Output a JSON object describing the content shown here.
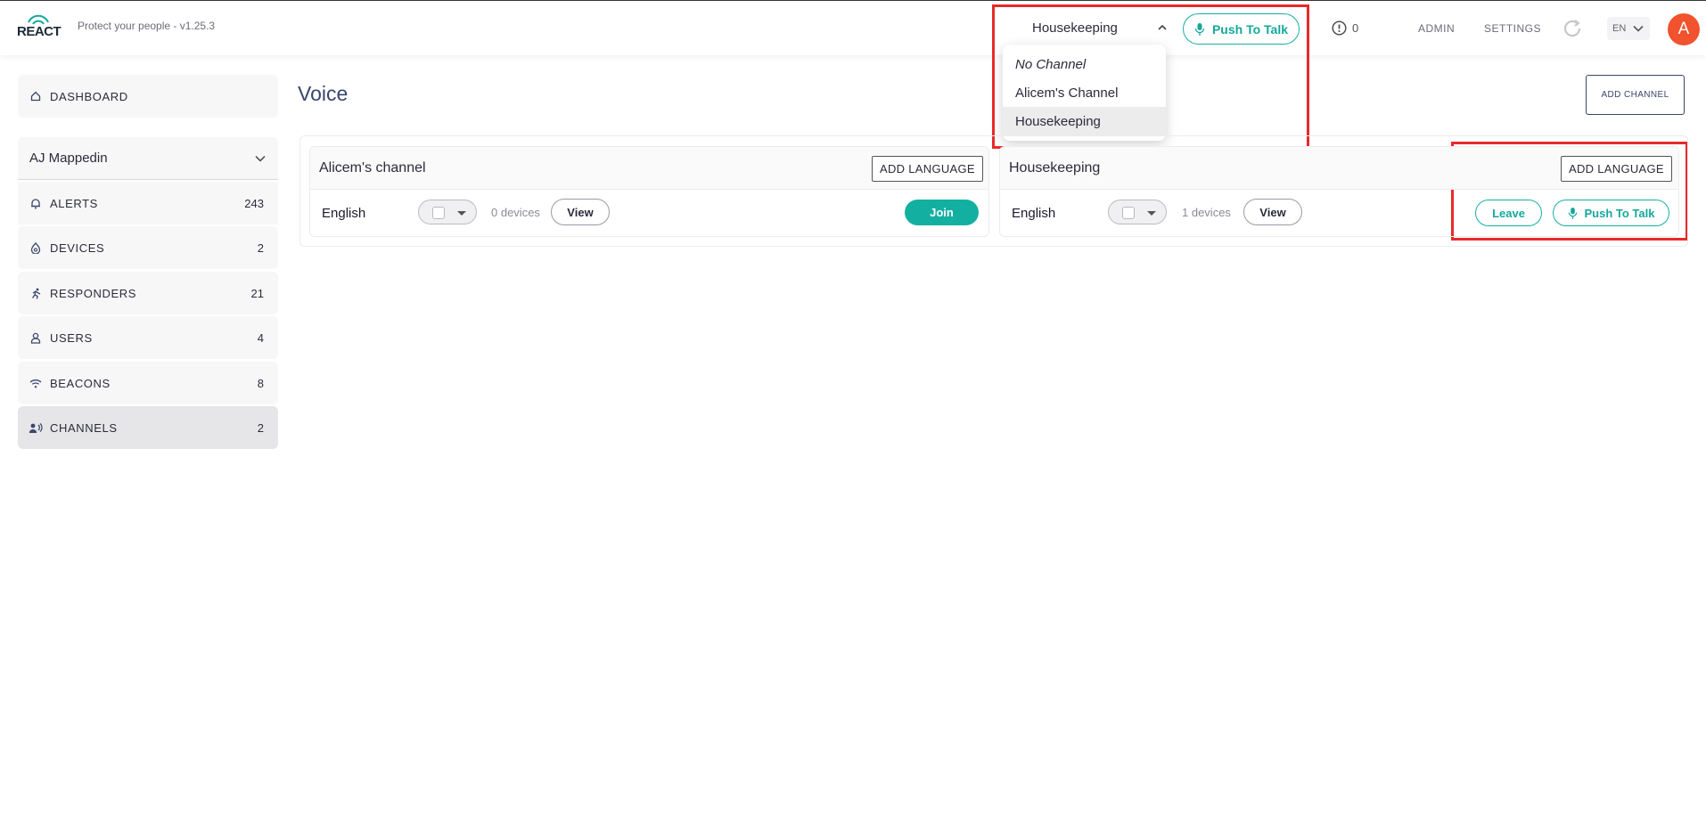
{
  "header": {
    "logo_text": "REACT",
    "tagline": "Protect your people - v1.25.3",
    "channel_select": {
      "value": "Housekeeping",
      "icon": "chevron-up-icon"
    },
    "push_to_talk": "Push To Talk",
    "alert_count": "0",
    "admin": "ADMIN",
    "settings": "SETTINGS",
    "language": "EN",
    "avatar_initial": "A"
  },
  "dropdown": {
    "options": [
      "No Channel",
      "Alicem's Channel",
      "Housekeeping"
    ],
    "selected": "Housekeeping"
  },
  "sidebar": {
    "dashboard": "DASHBOARD",
    "org": "AJ Mappedin",
    "items": [
      {
        "label": "ALERTS",
        "count": "243",
        "icon": "bell-icon"
      },
      {
        "label": "DEVICES",
        "count": "2",
        "icon": "device-icon"
      },
      {
        "label": "RESPONDERS",
        "count": "21",
        "icon": "runner-icon"
      },
      {
        "label": "USERS",
        "count": "4",
        "icon": "user-icon"
      },
      {
        "label": "BEACONS",
        "count": "8",
        "icon": "wifi-icon"
      },
      {
        "label": "CHANNELS",
        "count": "2",
        "icon": "channel-icon"
      }
    ]
  },
  "main": {
    "title": "Voice",
    "add_channel": "ADD CHANNEL",
    "channels": [
      {
        "name": "Alicem's channel",
        "add_language": "ADD LANGUAGE",
        "language": "English",
        "devices": "0 devices",
        "view": "View",
        "join": "Join"
      },
      {
        "name": "Housekeeping",
        "add_language": "ADD LANGUAGE",
        "language": "English",
        "devices": "1 devices",
        "view": "View",
        "leave": "Leave",
        "push_to_talk": "Push To Talk"
      }
    ]
  },
  "colors": {
    "accent": "#13b0a2",
    "highlight": "#e82a2a",
    "avatar": "#f0532d",
    "title": "#39466b"
  }
}
